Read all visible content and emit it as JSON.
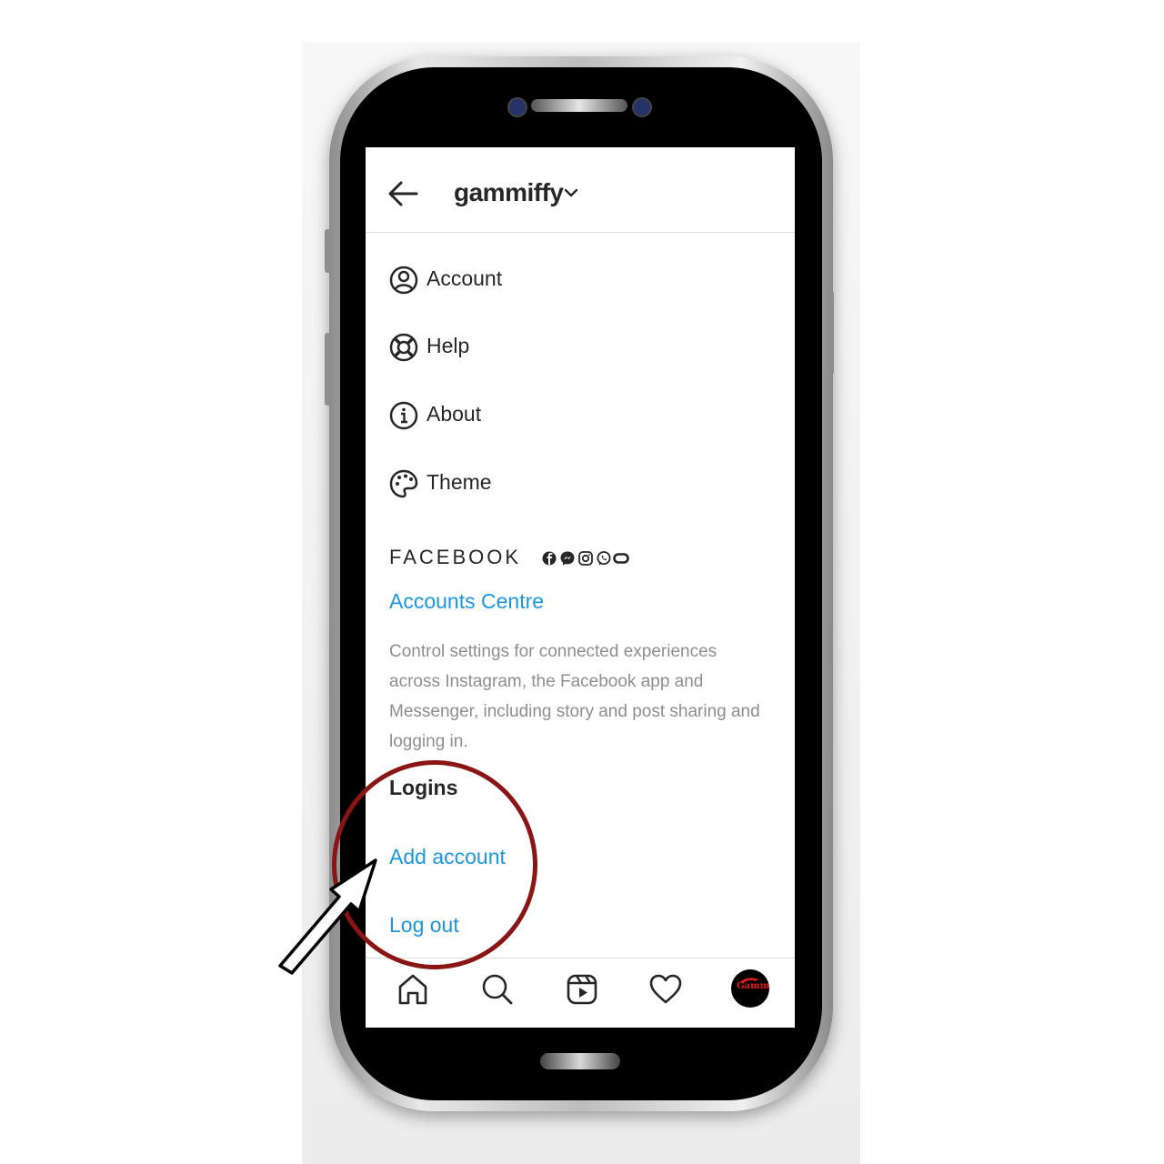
{
  "header": {
    "username": "gammiffy"
  },
  "menu": {
    "items": [
      {
        "label": "Account",
        "icon": "account-circle-icon"
      },
      {
        "label": "Help",
        "icon": "lifebuoy-icon"
      },
      {
        "label": "About",
        "icon": "info-icon"
      },
      {
        "label": "Theme",
        "icon": "palette-icon"
      }
    ]
  },
  "facebook": {
    "wordmark": "FACEBOOK",
    "icons": [
      "facebook-icon",
      "messenger-icon",
      "instagram-icon",
      "whatsapp-icon",
      "oculus-icon"
    ],
    "accounts_centre": "Accounts Centre",
    "description": "Control settings for connected experiences across Instagram, the Facebook app and Messenger, including story and post sharing and logging in."
  },
  "logins": {
    "heading": "Logins",
    "add_account": "Add account",
    "log_out": "Log out"
  },
  "navbar": {
    "items": [
      "home-icon",
      "search-icon",
      "reels-icon",
      "heart-icon",
      "profile-avatar"
    ]
  },
  "avatar": {
    "text": "Gamm"
  },
  "colors": {
    "link": "#1a97e0",
    "text": "#262626",
    "muted": "#8e8e8e",
    "annotation_ring": "#8b1414"
  }
}
